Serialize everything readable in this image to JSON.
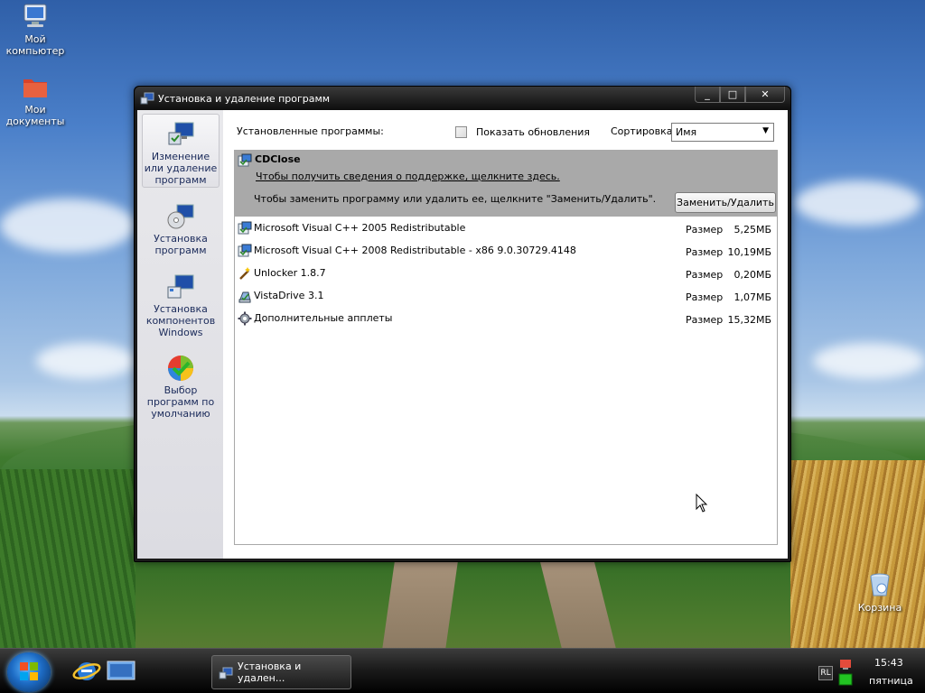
{
  "desktop": {
    "icons": [
      {
        "label": "Мой компьютер"
      },
      {
        "label": "Мои документы"
      },
      {
        "label": "Корзина"
      }
    ]
  },
  "window": {
    "title": "Установка и удаление программ",
    "buttons": {
      "minimize": "_",
      "maximize": "□",
      "close": "✕"
    }
  },
  "sidebar": {
    "items": [
      {
        "label": "Изменение или удаление программ",
        "active": true
      },
      {
        "label": "Установка программ",
        "active": false
      },
      {
        "label": "Установка компонентов Windows",
        "active": false
      },
      {
        "label": "Выбор программ по умолчанию",
        "active": false
      }
    ]
  },
  "main": {
    "installed_label": "Установленные программы:",
    "show_updates_label": "Показать обновления",
    "show_updates_checked": false,
    "sort_label": "Сортировка:",
    "sort_value": "Имя",
    "selected": {
      "name": "CDClose",
      "support_link": "Чтобы получить сведения о поддержке, щелкните здесь.",
      "hint": "Чтобы заменить программу или удалить  ее, щелкните \"Заменить/Удалить\".",
      "button": "Заменить/Удалить"
    },
    "programs": [
      {
        "name": "Microsoft Visual C++ 2005 Redistributable",
        "size_label": "Размер",
        "size": "5,25МБ"
      },
      {
        "name": "Microsoft Visual C++ 2008 Redistributable - x86 9.0.30729.4148",
        "size_label": "Размер",
        "size": "10,19МБ"
      },
      {
        "name": "Unlocker 1.8.7",
        "size_label": "Размер",
        "size": "0,20МБ"
      },
      {
        "name": "VistaDrive 3.1",
        "size_label": "Размер",
        "size": "1,07МБ"
      },
      {
        "name": "Дополнительные апплеты",
        "size_label": "Размер",
        "size": "15,32МБ"
      }
    ]
  },
  "taskbar": {
    "task_label": "Установка и удален...",
    "lang": "RL",
    "time": "15:43",
    "day": "пятница"
  }
}
